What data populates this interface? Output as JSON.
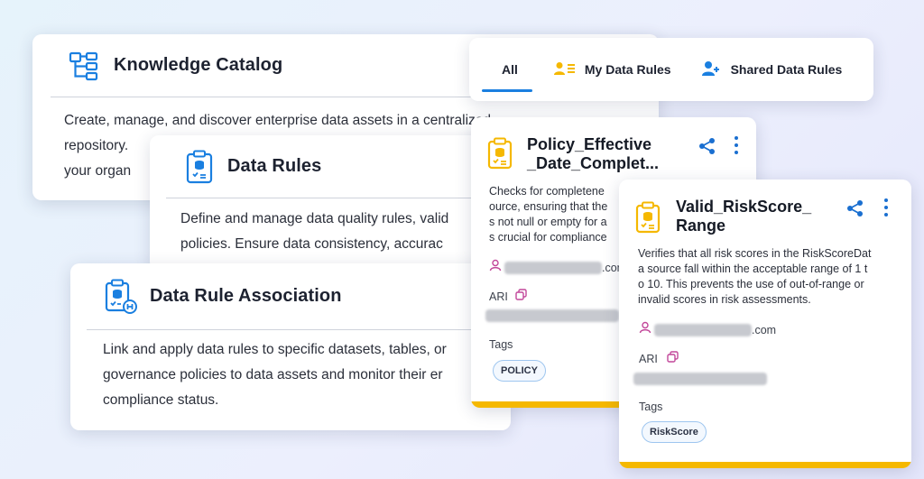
{
  "cards": {
    "knowledge_catalog": {
      "title": "Knowledge Catalog",
      "lines": [
        "Create, manage, and discover enterprise data assets in a centralized",
        "repository.",
        "your organ"
      ]
    },
    "data_rules": {
      "title": "Data Rules",
      "lines": [
        "Define and manage data quality rules, valid",
        "policies. Ensure data consistency, accurac"
      ]
    },
    "data_rule_association": {
      "title": "Data Rule Association",
      "lines": [
        "Link and apply data rules to specific datasets, tables, or",
        "governance policies to data assets and monitor their er",
        "compliance status."
      ]
    }
  },
  "tabs": {
    "all": "All",
    "my_data_rules": "My Data Rules",
    "shared_data_rules": "Shared Data Rules"
  },
  "rule_cards": {
    "policy": {
      "title_line1": "Policy_Effective",
      "title_line2": "_Date_Complet...",
      "desc_lines": [
        "Checks for completene",
        "ource, ensuring that the",
        "s not null or empty for a",
        "s crucial for compliance"
      ],
      "email_suffix": ".com",
      "ari_label": "ARI",
      "tags_label": "Tags",
      "tag": "POLICY"
    },
    "risk": {
      "title_line1": "Valid_RiskScore_",
      "title_line2": "Range",
      "desc_lines": [
        "Verifies that all risk scores in the RiskScoreDat",
        "a source fall within the acceptable range of 1 t",
        "o 10. This prevents the use of out-of-range or",
        "invalid scores in risk assessments."
      ],
      "email_suffix": ".com",
      "ari_label": "ARI",
      "tags_label": "Tags",
      "tag": "RiskScore"
    }
  },
  "colors": {
    "accent_blue": "#1a7fe0",
    "rule_yellow": "#f5b800",
    "tag_border": "#9ec6ef",
    "owner_pink": "#c2479a"
  }
}
